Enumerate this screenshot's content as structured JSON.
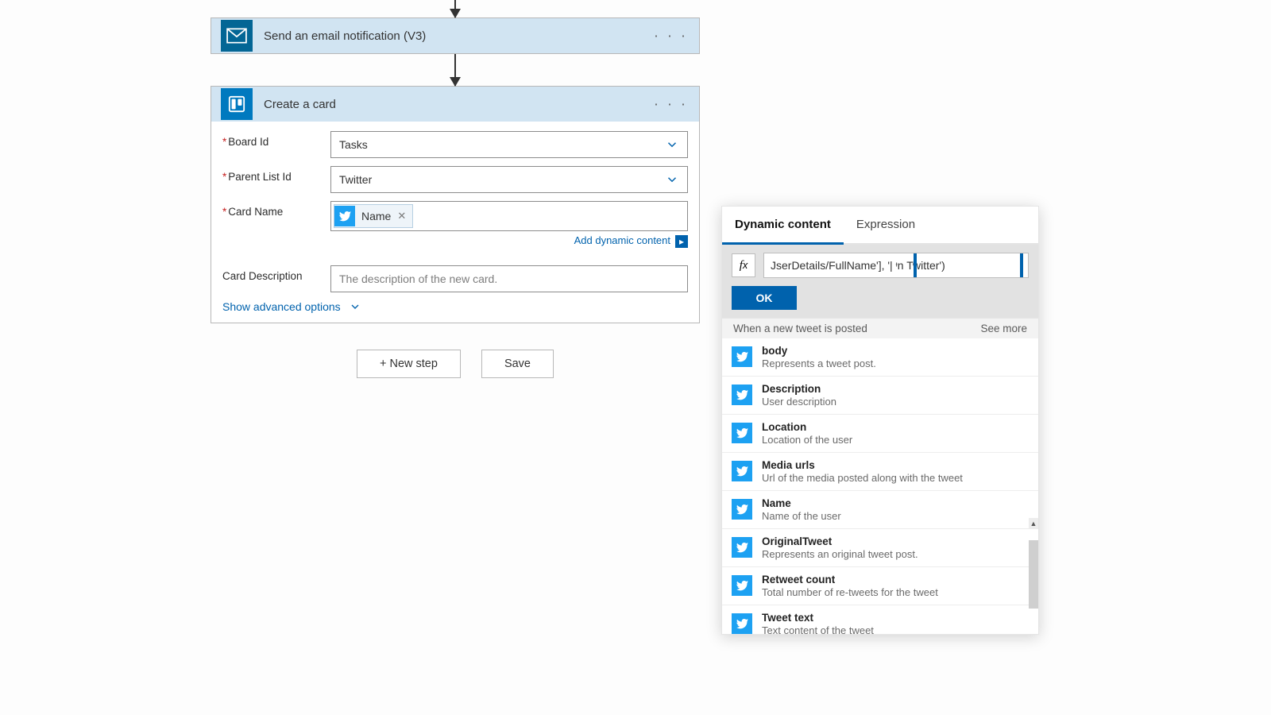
{
  "step1": {
    "title": "Send an email notification (V3)"
  },
  "step2": {
    "title": "Create a card",
    "boardLabel": "Board Id",
    "boardValue": "Tasks",
    "listLabel": "Parent List Id",
    "listValue": "Twitter",
    "nameLabel": "Card Name",
    "nameToken": "Name",
    "addDyn": "Add dynamic content",
    "descLabel": "Card Description",
    "descPlaceholder": "The description of the new card.",
    "advanced": "Show advanced options"
  },
  "buttons": {
    "newStep": "+ New step",
    "save": "Save"
  },
  "popout": {
    "tab1": "Dynamic content",
    "tab2": "Expression",
    "fx": "JserDetails/FullName'], '| ᶧn Twitter')",
    "ok": "OK",
    "sourceTitle": "When a new tweet is posted",
    "seeMore": "See more",
    "items": [
      {
        "title": "body",
        "desc": "Represents a tweet post."
      },
      {
        "title": "Description",
        "desc": "User description"
      },
      {
        "title": "Location",
        "desc": "Location of the user"
      },
      {
        "title": "Media urls",
        "desc": "Url of the media posted along with the tweet"
      },
      {
        "title": "Name",
        "desc": "Name of the user"
      },
      {
        "title": "OriginalTweet",
        "desc": "Represents an original tweet post."
      },
      {
        "title": "Retweet count",
        "desc": "Total number of re-tweets for the tweet"
      },
      {
        "title": "Tweet text",
        "desc": "Text content of the tweet"
      }
    ]
  }
}
